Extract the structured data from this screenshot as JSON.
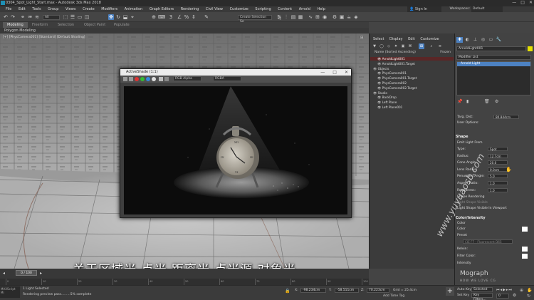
{
  "window": {
    "title": "0304_Spot_Light_Start.max - Autodesk 3ds Max 2018",
    "controls": [
      "—",
      "□",
      "✕"
    ]
  },
  "menu": [
    "File",
    "Edit",
    "Tools",
    "Group",
    "Views",
    "Create",
    "Modifiers",
    "Animation",
    "Graph Editors",
    "Rendering",
    "Civil View",
    "Customize",
    "Scripting",
    "Content",
    "Arnold",
    "Help"
  ],
  "account": {
    "signin": "Sign In",
    "workspaces_label": "Workspaces:",
    "workspace": "Default"
  },
  "toolbar": {
    "filter": "All",
    "selection_set": "Create Selection Se"
  },
  "ribbon": {
    "tabs": [
      "Modeling",
      "Freeform",
      "Selection",
      "Object Paint",
      "Populate"
    ],
    "active": "Modeling",
    "sub": "Polygon Modeling"
  },
  "viewport": {
    "label": "[+] [PhysCamera001] [Standard] [Default Shading]"
  },
  "activeshade": {
    "title": "ActiveShade (1:1)",
    "channel": "RGB Alpha",
    "display": "RGBA"
  },
  "subtitle": "关于区域光 点光 距离光  点光源  对象光",
  "timeline": {
    "frame": "0 / 100",
    "ticks": [
      "0",
      "10",
      "20",
      "30",
      "40",
      "50",
      "60",
      "70",
      "80",
      "90",
      "100"
    ]
  },
  "status": {
    "maxscript": "MAXScript Mi",
    "selected": "1 Light Selected",
    "prompt": "Rendering preview pass.........5% complete",
    "x": "-98.234cm",
    "y": "-58.511cm",
    "z": "70.223cm",
    "grid": "Grid = 25.4cm",
    "add_time_tag": "Add Time Tag",
    "auto_key": "Auto Key",
    "set_key": "Set Key",
    "selected_drop": "Selected",
    "key_filters": "Key Filters...",
    "frame": "0"
  },
  "scene_explorer": {
    "menu": [
      "Select",
      "Display",
      "Edit",
      "Customize"
    ],
    "header_name": "Name (Sorted Ascending)",
    "header_frozen": "Frozen",
    "items": [
      {
        "name": "ArnoldLight001",
        "indent": 1,
        "selected": true
      },
      {
        "name": "ArnoldLight001.Target",
        "indent": 1,
        "selected": false
      },
      {
        "name": "Objects",
        "indent": 0,
        "selected": false
      },
      {
        "name": "PhysCamera001",
        "indent": 1,
        "selected": false
      },
      {
        "name": "PhysCamera001.Target",
        "indent": 1,
        "selected": false
      },
      {
        "name": "PhysCamera002",
        "indent": 1,
        "selected": false
      },
      {
        "name": "PhysCamera002.Target",
        "indent": 1,
        "selected": false
      },
      {
        "name": "Studio",
        "indent": 0,
        "selected": false
      },
      {
        "name": "BackDrop",
        "indent": 1,
        "selected": false
      },
      {
        "name": "Left Plane",
        "indent": 1,
        "selected": false
      },
      {
        "name": "Left Plane001",
        "indent": 1,
        "selected": false
      }
    ]
  },
  "command_panel": {
    "object_name": "ArnoldLight001",
    "modifier_list": "Modifier List",
    "stack_item": "Arnold Light",
    "targ_dist_label": "Targ. Dist:",
    "targ_dist": "80.844cm",
    "user_options": "User Options:",
    "shape_section": "Shape",
    "emit_light_from": "Emit Light From",
    "params": [
      {
        "label": "Type:",
        "value": "Spot"
      },
      {
        "label": "Radius:",
        "value": "12.7cm"
      },
      {
        "label": "Cone Angle:",
        "value": "20.0"
      },
      {
        "label": "Lens Radius:",
        "value": "0.0cm"
      },
      {
        "label": "Penumbra Angle:",
        "value": "5.0"
      },
      {
        "label": "Aspect Ratio:",
        "value": "1.0"
      },
      {
        "label": "Roundness:",
        "value": "1.0"
      }
    ],
    "shape_render": "Shape Rendering",
    "light_shape_visible": "Light Shape Visible",
    "show_viewport": "Light Shape Visible In Viewport",
    "color_section": "Color/Intensity",
    "color_label": "Color",
    "color_opt": "Color",
    "preset_opt": "Preset",
    "preset_val": "CIE F7 - Fluorescent D65",
    "kelvin": "Kelvin:",
    "filter_color": "Filter Color:",
    "intensity": "Intensity"
  },
  "watermark": {
    "site": "www.yuyuaosb.com",
    "brand": "Mograph",
    "brand_sub": "HOW WE LOVE CG"
  },
  "colors": {
    "accent": "#4d82c2",
    "selected_row": "#5a2626"
  }
}
